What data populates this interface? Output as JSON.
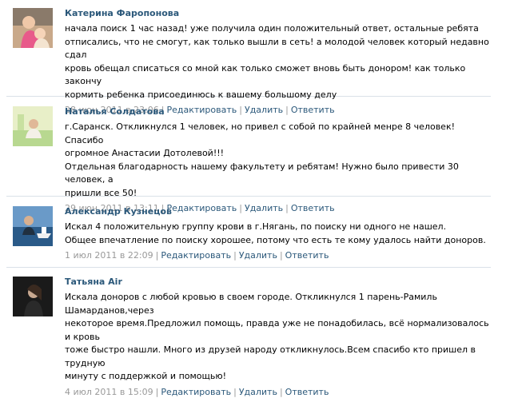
{
  "comments": [
    {
      "author": "Катерина Фаропонова",
      "text": "начала поиск 1 час назад! уже получила один положительный ответ, остальные ребята\nотписались, что не смогут, как только вышли в сеть! а молодой человек который недавно сдал\nкровь обещал списаться со мной как только сможет вновь быть донором! как только закончу\nкормить ребенка присоединюсь к вашему большому делу",
      "date": "28 июн 2011 в 23:06",
      "actions": {
        "edit": "Редактировать",
        "delete": "Удалить",
        "reply": "Ответить"
      }
    },
    {
      "author": "Наталья Солдатова",
      "text": "г.Саранск. Откликнулся 1 человек, но привел с собой по крайней менре 8 человек! Спасибо\nогромное Анастасии Дотолевой!!!\nОтдельная благодарность нашему факультету и ребятам! Нужно было привести 30 человек, а\nпришли все 50!",
      "date": "29 июн 2011 в 13:11",
      "actions": {
        "edit": "Редактировать",
        "delete": "Удалить",
        "reply": "Ответить"
      }
    },
    {
      "author": "Александр Кузнецов",
      "text": "Искал 4 положительную группу крови в г.Нягань, по поиску ни одного не нашел.\nОбщее впечатление по поиску хорошее, потому что есть те кому удалось найти доноров.",
      "date": "1 июл 2011 в 22:09",
      "actions": {
        "edit": "Редактировать",
        "delete": "Удалить",
        "reply": "Ответить"
      }
    },
    {
      "author": "Татьяна Air",
      "text": "Искала доноров с любой кровью в своем городе. Откликнулся 1 парень-Рамиль Шамарданов,через\nнекоторое время.Предложил помощь, правда уже не понадобилась, всё нормализовалось и кровь\nтоже быстро нашли. Много из друзей народу откликнулось.Всем спасибо кто пришел в трудную\nминуту с поддержкой и помощью!",
      "date": "4 июл 2011 в 15:09",
      "actions": {
        "edit": "Редактировать",
        "delete": "Удалить",
        "reply": "Ответить"
      }
    }
  ]
}
